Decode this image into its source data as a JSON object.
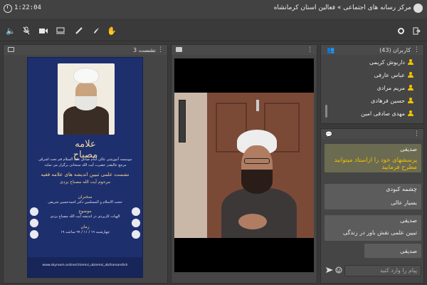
{
  "topbar": {
    "timer": "1:22:04",
    "title": "مرکز رسانه های اجتماعی » فعالین استان کرمانشاه"
  },
  "toolbar": {
    "left_icons": [
      "speaker-icon",
      "mic-off-icon",
      "camera-icon",
      "screen-share-icon",
      "pencil-icon",
      "brush-icon",
      "raise-hand-icon"
    ],
    "right_icons": [
      "settings-icon",
      "exit-icon"
    ]
  },
  "presentation": {
    "title": "نشست 3",
    "poster": {
      "calligraphy": "علامه مصباح",
      "blurb_lines": [
        "موسسه آموزشی عالی امام صادق علیه السلام قم تحت اشراف",
        "مرجع عالیقدر حضرت آیت الله سبحانی برگزار می نماید."
      ],
      "gold_line_1": "نشست علمی تبیین اندیشه های علامه فقیه",
      "gold_line_2": "مرحوم آیت الله مصباح یزدی",
      "speaker_label": "سخنران",
      "speaker_name": "حجت الاسلام و المسلمین دکتر احمدحسین شریفی",
      "topic_label": "موضوع",
      "topic": "الهیات کاربردی در اندیشه آیت الله مصباح یزدی",
      "time_label": "زمان",
      "time": "چهارشنبه ۱۹ / ۱۱ / ۹۹ ساعت ۱۹",
      "footer": "www.skyroom.online/ch/emsi_ub/emsi_ab/hamandish"
    }
  },
  "video": {
    "panel_icon": "video-icon"
  },
  "users": {
    "title": "کاربران (43)",
    "list": [
      "داریوش کریمی",
      "عباس عارفی",
      "مریم مرادی",
      "حسین فرهادی",
      "مهدی صادقی امین"
    ]
  },
  "chat": {
    "messages": [
      {
        "author": "صدیقی",
        "text": "پرسشهای خود را ازاستاد میتوانید مطرح فرمایید",
        "highlight": true
      },
      {
        "author": "چشمه کبودی",
        "text": "بسیار عالی",
        "highlight": false
      },
      {
        "author": "صدیقی",
        "text": "تبیین علمی نقش باور در زندگی",
        "highlight": false
      },
      {
        "author": "صدیقی",
        "text": "",
        "highlight": false
      }
    ],
    "input_placeholder": "پیام را وارد کنید"
  }
}
